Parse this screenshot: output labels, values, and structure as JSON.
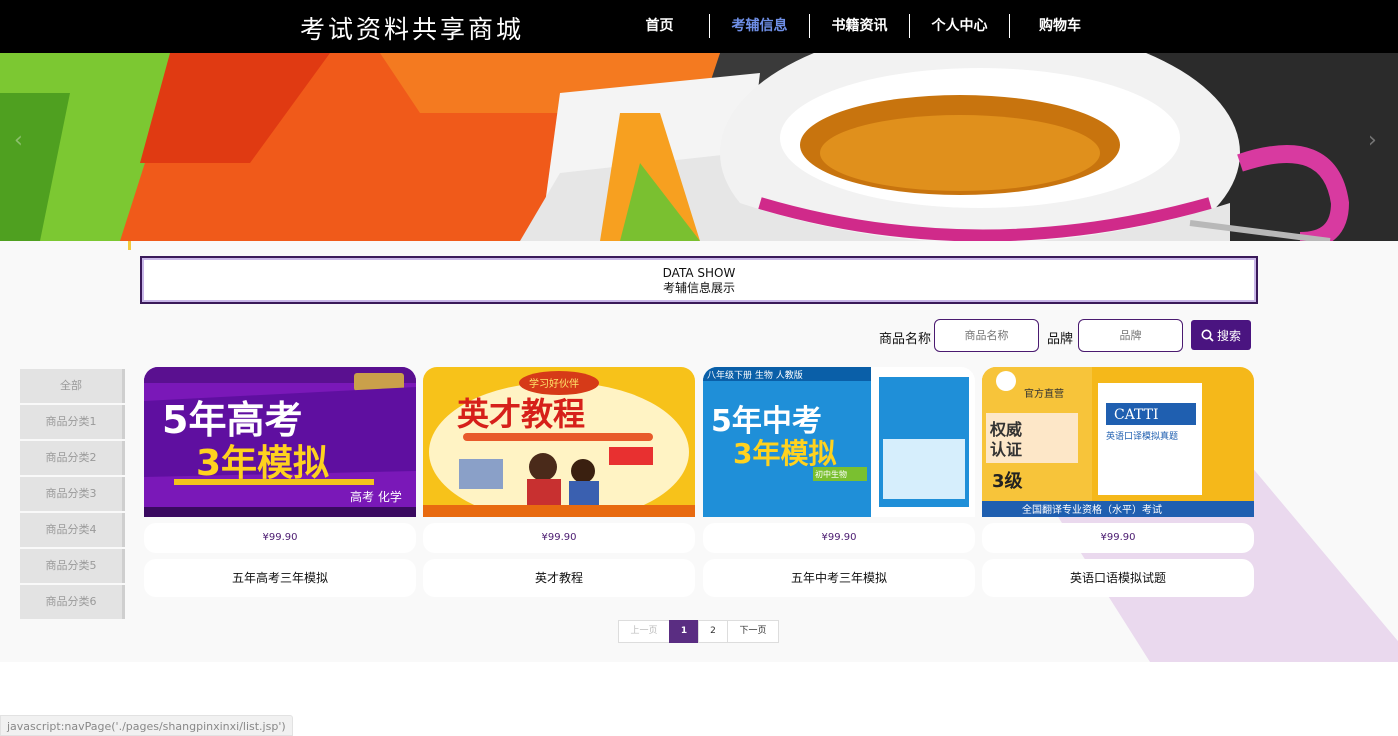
{
  "header": {
    "site_title": "考试资料共享商城",
    "nav": [
      {
        "label": "首页",
        "active": false
      },
      {
        "label": "考辅信息",
        "active": true
      },
      {
        "label": "书籍资讯",
        "active": false
      },
      {
        "label": "个人中心",
        "active": false
      },
      {
        "label": "购物车",
        "active": false
      }
    ]
  },
  "banner": {
    "prev_icon": "chevron-left-icon",
    "next_icon": "chevron-right-icon",
    "arrow_prev": "‹",
    "arrow_next": "›"
  },
  "section": {
    "title_en": "DATA SHOW",
    "title_cn": "考辅信息展示"
  },
  "search": {
    "name_label": "商品名称",
    "name_placeholder": "商品名称",
    "brand_label": "品牌",
    "brand_placeholder": "品牌",
    "button_label": "搜索",
    "button_icon": "search-icon"
  },
  "categories": [
    "全部",
    "商品分类1",
    "商品分类2",
    "商品分类3",
    "商品分类4",
    "商品分类5",
    "商品分类6"
  ],
  "products": [
    {
      "name": "五年高考三年模拟",
      "price": "¥99.90",
      "cover_line1": "5年高考",
      "cover_line2": "3年模拟",
      "cover_side": "高考 化学"
    },
    {
      "name": "英才教程",
      "price": "¥99.90",
      "cover_line1": "英才教程",
      "cover_top": "学习好伙伴"
    },
    {
      "name": "五年中考三年模拟",
      "price": "¥99.90",
      "cover_line1": "5年中考",
      "cover_line2": "3年模拟",
      "cover_top": "八年级下册 生物 人教版",
      "cover_side": "初中生物"
    },
    {
      "name": "英语口语模拟试题",
      "price": "¥99.90",
      "cover_line1": "权威",
      "cover_line2": "认证",
      "cover_top": "官方直营",
      "cover_level": "3级",
      "cover_side": "英语口译模拟真题",
      "cover_brand": "CATTI",
      "cover_bottom": "全国翻译专业资格（水平）考试"
    }
  ],
  "pagination": {
    "prev": "上一页",
    "pages": [
      "1",
      "2"
    ],
    "current": "1",
    "next": "下一页"
  },
  "status_bar": "javascript:navPage('./pages/shangpinxinxi/list.jsp')",
  "colors": {
    "header_bg": "#000000",
    "nav_active": "#6f8fe6",
    "accent_purple": "#4a1480",
    "page_current": "#5a2d82",
    "deco_lilac": "#e8d9ee"
  }
}
